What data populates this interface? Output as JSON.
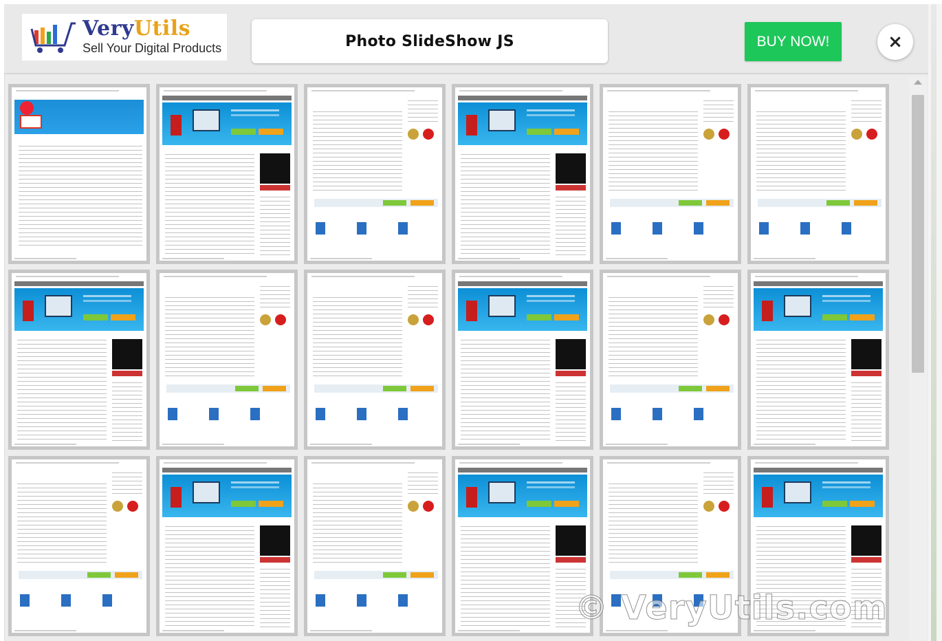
{
  "header": {
    "logo": {
      "brand_first": "Very",
      "brand_second": "Utils",
      "tagline": "Sell Your Digital Products",
      "icon": "shopping-cart-bars-icon"
    },
    "title": "Photo SlideShow JS",
    "buy_label": "BUY NOW!",
    "close_symbol": "×"
  },
  "colors": {
    "buy_button": "#1ec75a",
    "brand_blue": "#2f3a8f",
    "brand_orange": "#e8a21a"
  },
  "gallery": {
    "rows": 3,
    "columns": 6,
    "thumbnail_count": 18
  },
  "watermark": "© VeryUtils.com"
}
